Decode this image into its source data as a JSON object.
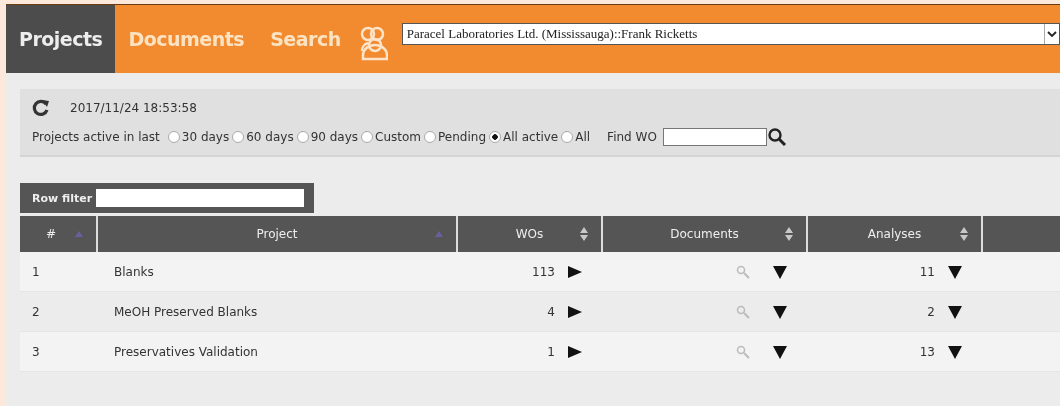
{
  "nav": {
    "tabs": [
      {
        "label": "Projects",
        "selected": true
      },
      {
        "label": "Documents",
        "selected": false
      },
      {
        "label": "Search",
        "selected": false
      }
    ],
    "account": "Paracel Laboratories Ltd. (Mississauga)::Frank Ricketts"
  },
  "filters": {
    "timestamp": "2017/11/24 18:53:58",
    "label": "Projects active in last",
    "options": [
      {
        "label": "30 days",
        "selected": false
      },
      {
        "label": "60 days",
        "selected": false
      },
      {
        "label": "90 days",
        "selected": false
      },
      {
        "label": "Custom",
        "selected": false
      },
      {
        "label": "Pending",
        "selected": false
      },
      {
        "label": "All active",
        "selected": true
      },
      {
        "label": "All",
        "selected": false
      }
    ],
    "find_label": "Find WO"
  },
  "row_filter": {
    "label": "Row filter"
  },
  "table": {
    "columns": [
      {
        "label": "#",
        "kind": "sorted"
      },
      {
        "label": "Project",
        "kind": "sorted"
      },
      {
        "label": "WOs",
        "kind": "sortable"
      },
      {
        "label": "Documents",
        "kind": "sortable"
      },
      {
        "label": "Analyses",
        "kind": "sortable"
      }
    ],
    "rows": [
      {
        "number": "1",
        "project": "Blanks",
        "wos": "113",
        "analyses": "11"
      },
      {
        "number": "2",
        "project": "MeOH Preserved Blanks",
        "wos": "4",
        "analyses": "2"
      },
      {
        "number": "3",
        "project": "Preservatives Validation",
        "wos": "1",
        "analyses": "13"
      }
    ]
  }
}
